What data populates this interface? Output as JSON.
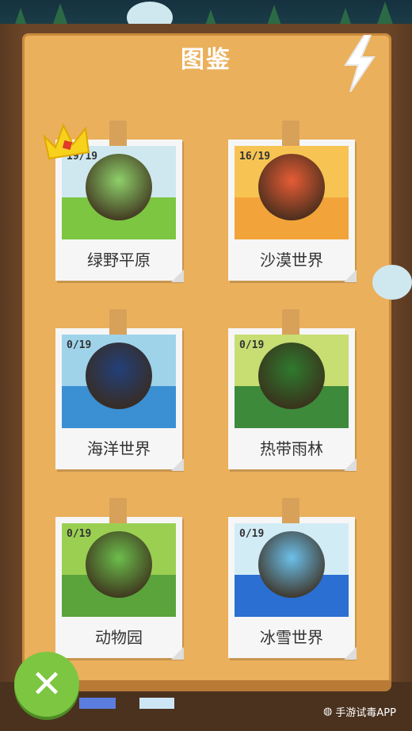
{
  "screen": {
    "title": "图鉴"
  },
  "cards": [
    {
      "name": "绿野平原",
      "count": "19/19",
      "sky": "#cfe8ef",
      "ground": "#7cc641",
      "globe": "#8fd06a"
    },
    {
      "name": "沙漠世界",
      "count": "16/19",
      "sky": "#f7c453",
      "ground": "#f2a43a",
      "globe": "#e65c36"
    },
    {
      "name": "海洋世界",
      "count": "0/19",
      "sky": "#9fd3ea",
      "ground": "#3b8fd3",
      "globe": "#23407a"
    },
    {
      "name": "热带雨林",
      "count": "0/19",
      "sky": "#c8dd72",
      "ground": "#3d8a3b",
      "globe": "#2f7a2e"
    },
    {
      "name": "动物园",
      "count": "0/19",
      "sky": "#9bcf52",
      "ground": "#5aa43b",
      "globe": "#6cbd4c"
    },
    {
      "name": "冰雪世界",
      "count": "0/19",
      "sky": "#d2ecf6",
      "ground": "#2a6fd1",
      "globe": "#6cc0ea"
    }
  ],
  "watermark": {
    "text": "手游试毒APP"
  },
  "icons": {
    "close": "close-icon",
    "lightning": "lightning-icon",
    "crown": "crown-icon"
  },
  "colors": {
    "board": "#eab05c",
    "close_button": "#7cc641"
  }
}
